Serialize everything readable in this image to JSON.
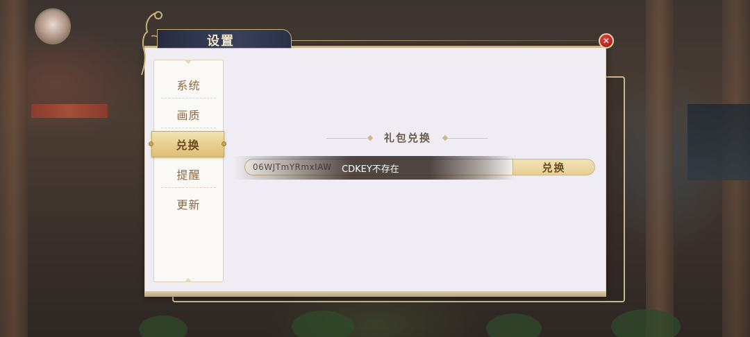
{
  "window": {
    "title": "设置"
  },
  "icons": {
    "close": "close-icon"
  },
  "sidebar": {
    "items": [
      {
        "label": "系统",
        "active": false
      },
      {
        "label": "画质",
        "active": false
      },
      {
        "label": "兑换",
        "active": true
      },
      {
        "label": "提醒",
        "active": false
      },
      {
        "label": "更新",
        "active": false
      }
    ]
  },
  "redeem": {
    "section_title": "礼包兑换",
    "code_value": "06WJTmYRmxIAW",
    "button_label": "兑换"
  },
  "toast": {
    "message": "CDKEY不存在"
  },
  "colors": {
    "accent_gold": "#c9b27a",
    "title_bar": "#2a3046",
    "close_red": "#c42a2a",
    "panel_bg": "#efedf3"
  }
}
